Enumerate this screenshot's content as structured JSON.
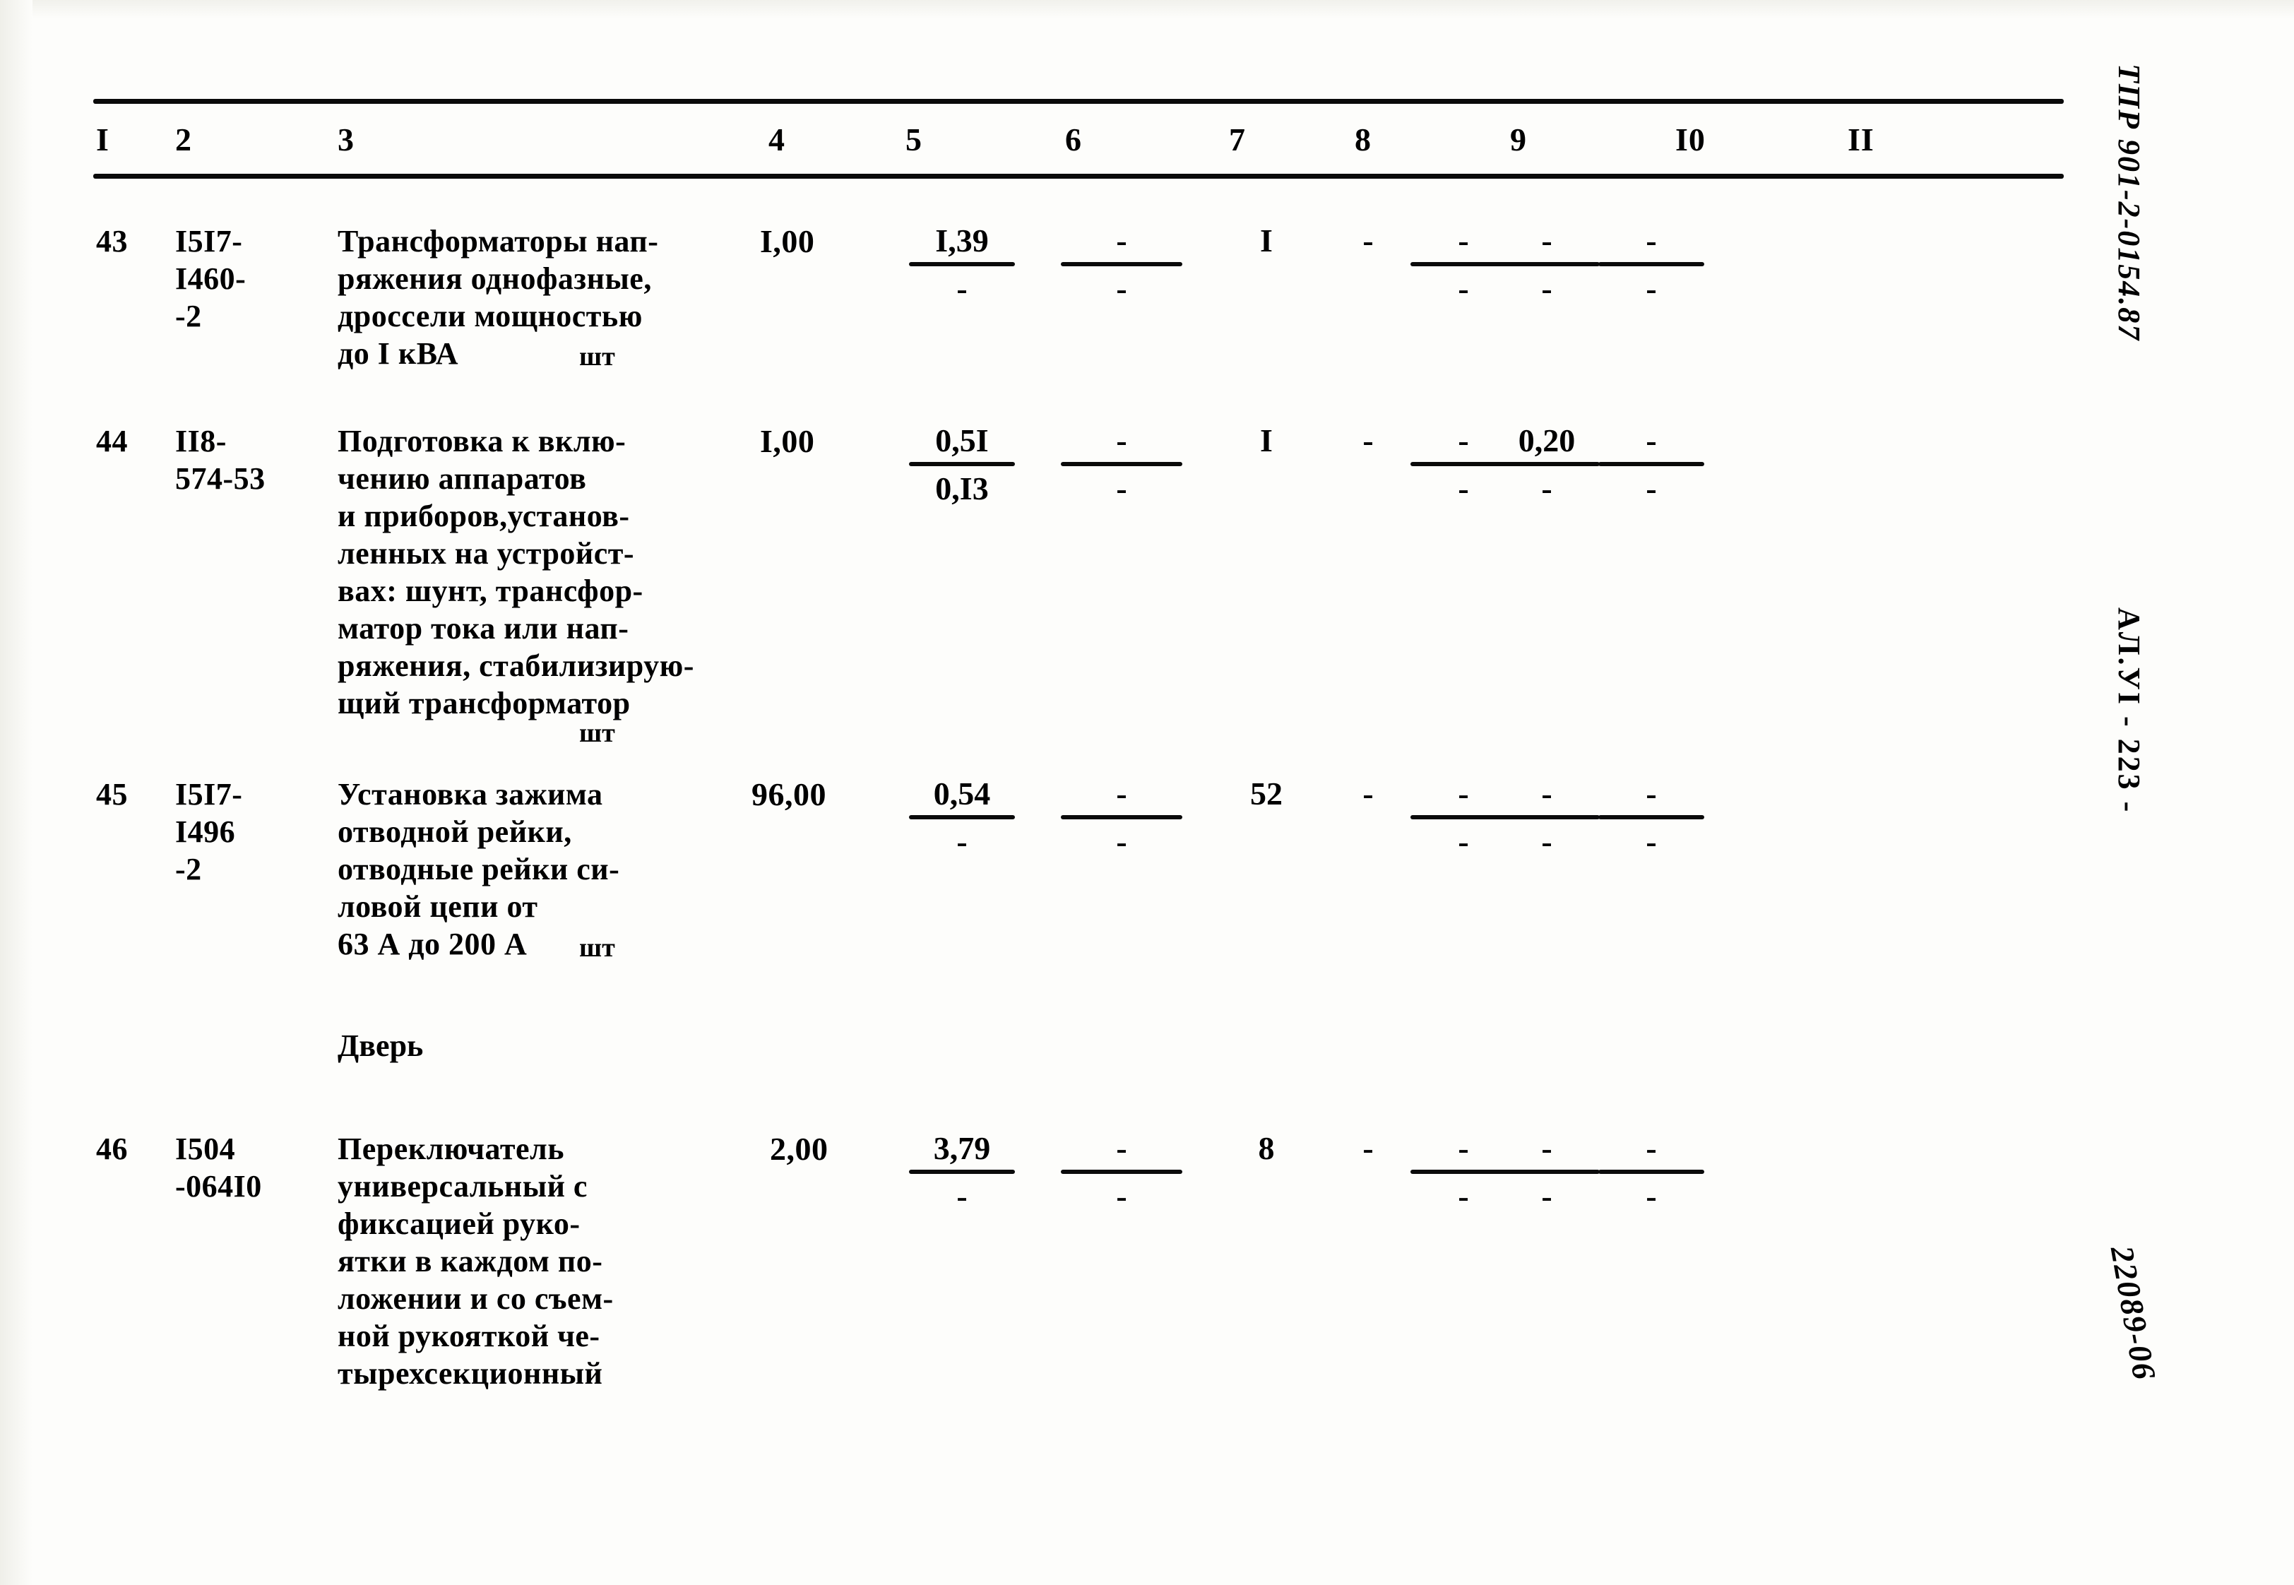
{
  "document": {
    "side_code": "ТПР 901-2-0154.87",
    "side_sheet": "АЛ.УI  - 223 -",
    "handwritten_note": "22089-06"
  },
  "table": {
    "column_headers": [
      "I",
      "2",
      "3",
      "4",
      "5",
      "6",
      "7",
      "8",
      "9",
      "I0",
      "II"
    ],
    "rows": [
      {
        "index": "43",
        "code": "I5I7-\nI460-\n-2",
        "description": "Трансформаторы нап-\nряжения однофазные,\nдроссели мощностью\nдо I кВА",
        "unit": "шт",
        "qty": "I,00",
        "col5_top": "I,39",
        "col5_bot": "-",
        "col6_top": "-",
        "col6_bot": "-",
        "col7": "I",
        "col8": "-",
        "col9_top": "-",
        "col9_bot": "-",
        "col10_top": "-",
        "col10_bot": "-",
        "col11_top": "-",
        "col11_bot": "-"
      },
      {
        "index": "44",
        "code": "II8-\n574-53",
        "description": "Подготовка к вклю-\nчению аппаратов\nи приборов,установ-\nленных на устройст-\nвах: шунт, трансфор-\nматор тока или нап-\nряжения, стабилизирую-\nщий трансформатор",
        "unit": "шт",
        "qty": "I,00",
        "col5_top": "0,5I",
        "col5_bot": "0,I3",
        "col6_top": "-",
        "col6_bot": "-",
        "col7": "I",
        "col8": "-",
        "col9_top": "-",
        "col9_bot": "-",
        "col10_top": "0,20",
        "col10_bot": "-",
        "col11_top": "-",
        "col11_bot": "-"
      },
      {
        "index": "45",
        "code": "I5I7-\nI496\n-2",
        "description": "Установка зажима\nотводной рейки,\nотводные рейки си-\nловой цепи от\n63 А до 200 А",
        "unit": "шт",
        "qty": "96,00",
        "col5_top": "0,54",
        "col5_bot": "-",
        "col6_top": "-",
        "col6_bot": "-",
        "col7": "52",
        "col8": "-",
        "col9_top": "-",
        "col9_bot": "-",
        "col10_top": "-",
        "col10_bot": "-",
        "col11_top": "-",
        "col11_bot": "-"
      },
      {
        "index": "46",
        "code": "I504\n-064I0",
        "description": "Переключатель\nуниверсальный с\nфиксацией руко-\nятки в каждом по-\nложении и со съем-\nной рукояткой че-\nтырехсекционный",
        "unit": "",
        "qty": "2,00",
        "col5_top": "3,79",
        "col5_bot": "-",
        "col6_top": "-",
        "col6_bot": "-",
        "col7": "8",
        "col8": "-",
        "col9_top": "-",
        "col9_bot": "-",
        "col10_top": "-",
        "col10_bot": "-",
        "col11_top": "-",
        "col11_bot": "-"
      }
    ],
    "section_label": "Дверь"
  }
}
